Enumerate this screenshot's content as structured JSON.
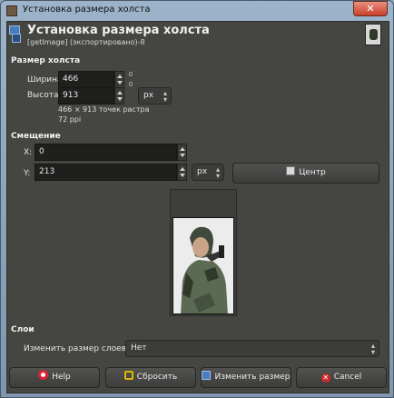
{
  "window": {
    "title": "Установка размера холста",
    "close_glyph": "✕"
  },
  "header": {
    "title": "Установка размера холста",
    "subtitle": "[getImage] (экспортировано)-8"
  },
  "canvas_size": {
    "section": "Размер холста",
    "width_label": "Ширина:",
    "width_value": "466",
    "height_label": "Высота:",
    "height_value": "913",
    "unit": "px",
    "chain_top": "0",
    "chain_bottom": "0",
    "dimensions_text": "466 × 913 точек растра",
    "resolution_text": "72 ppi"
  },
  "offset": {
    "section": "Смещение",
    "x_label": "X:",
    "x_value": "0",
    "y_label": "Y:",
    "y_value": "213",
    "unit": "px",
    "center_label": "Центр"
  },
  "layers": {
    "section": "Слои",
    "resize_label": "Изменить размер слоев:",
    "resize_value": "Нет"
  },
  "buttons": {
    "help": "Help",
    "reset": "Сбросить",
    "resize": "Изменить размер",
    "cancel": "Cancel"
  },
  "icons": [
    "window-app-icon",
    "canvas-size-icon",
    "image-thumbnail-icon",
    "help-lifebuoy-icon",
    "reset-icon",
    "resize-icon",
    "cancel-icon",
    "center-icon"
  ]
}
